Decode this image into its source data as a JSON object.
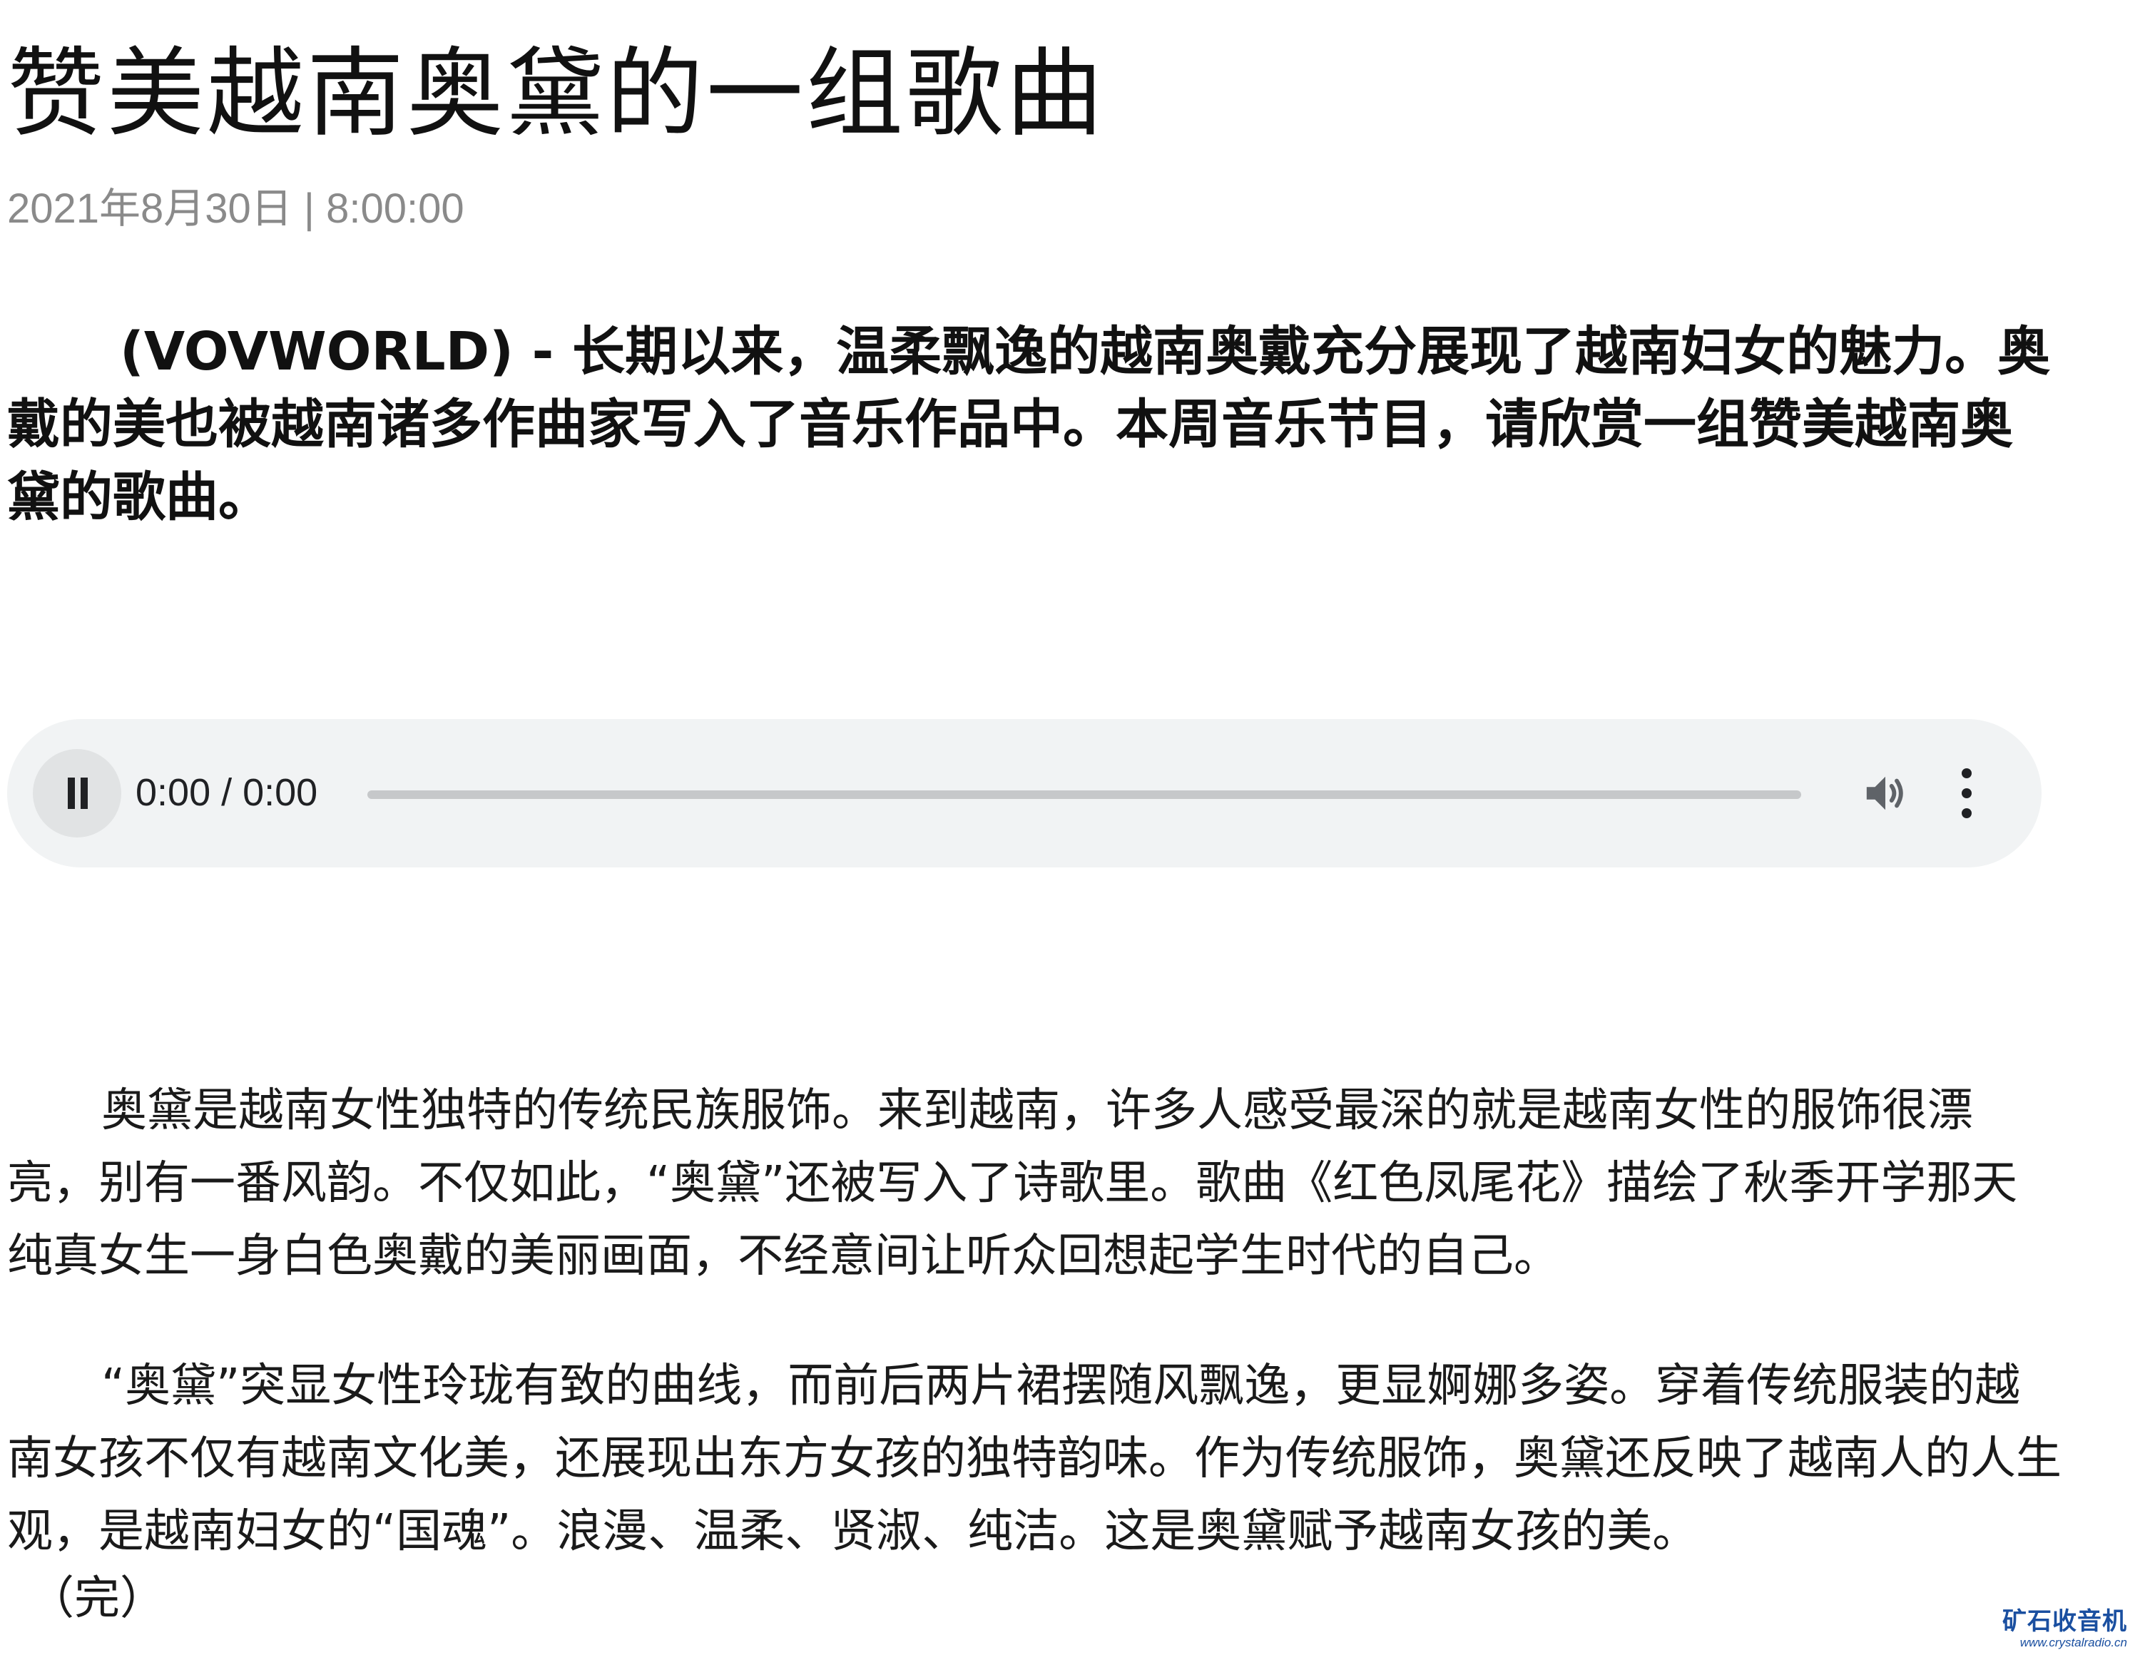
{
  "article": {
    "title": "赞美越南奥黛的一组歌曲",
    "dateline": "2021年8月30日 | 8:00:00",
    "lead": "(VOVWORLD) - 长期以来，温柔飘逸的越南奥戴充分展现了越南妇女的魅力。奥戴的美也被越南诸多作曲家写入了音乐作品中。本周音乐节目，请欣赏一组赞美越南奥黛的歌曲。",
    "paragraphs": [
      "奥黛是越南女性独特的传统民族服饰。来到越南，许多人感受最深的就是越南女性的服饰很漂亮，别有一番风韵。不仅如此，“奥黛”还被写入了诗歌里。歌曲《红色凤尾花》描绘了秋季开学那天纯真女生一身白色奥戴的美丽画面，不经意间让听众回想起学生时代的自己。",
      "“奥黛”突显女性玲珑有致的曲线，而前后两片裙摆随风飘逸，更显婀娜多姿。穿着传统服装的越南女孩不仅有越南文化美，还展现出东方女孩的独特韵味。作为传统服饰，奥黛还反映了越南人的人生观，是越南妇女的“国魂”。浪漫、温柔、贤淑、纯洁。这是奥黛赋予越南女孩的美。"
    ],
    "end_note": "（完）"
  },
  "audio_player": {
    "state": "playing",
    "time": "0:00 / 0:00",
    "progress": 0,
    "icons": {
      "play_pause": "pause-icon",
      "volume": "volume-icon",
      "more": "more-vertical-icon"
    },
    "colors": {
      "background": "#f1f3f4",
      "track": "#c6c8ca",
      "icon": "#202124"
    }
  },
  "watermark": {
    "name": "矿石收音机",
    "url": "www.crystalradio.cn"
  }
}
